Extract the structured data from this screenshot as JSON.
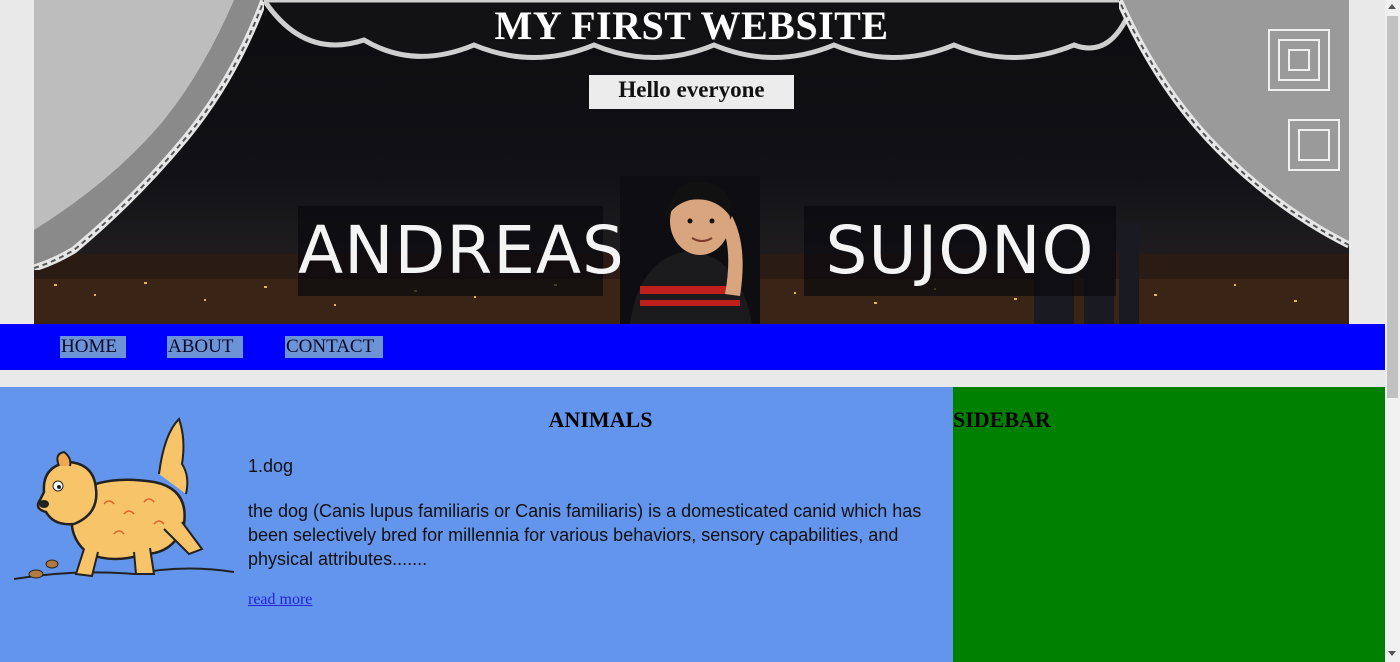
{
  "header": {
    "site_title": "MY FIRST WEBSITE",
    "greeting": "Hello everyone",
    "name_first": "ANDREAS",
    "name_last": "SUJONO"
  },
  "nav": {
    "items": [
      {
        "label": "HOME"
      },
      {
        "label": "ABOUT"
      },
      {
        "label": "CONTACT"
      }
    ],
    "bar_color": "#0000ff",
    "link_bg": "#6c93d6"
  },
  "main": {
    "section_title": "ANIMALS",
    "item_title": "1.dog",
    "item_description": "the dog (Canis lupus familiaris or Canis familiaris) is a domesticated canid which has been selectively bred for millennia for various behaviors, sensory capabilities, and physical attributes.......",
    "read_more": "read more",
    "background": "#6495ed"
  },
  "sidebar": {
    "title": "SIDEBAR",
    "background": "#008000"
  },
  "icons": {
    "dog": "dog-illustration",
    "portrait": "boy-portrait"
  }
}
